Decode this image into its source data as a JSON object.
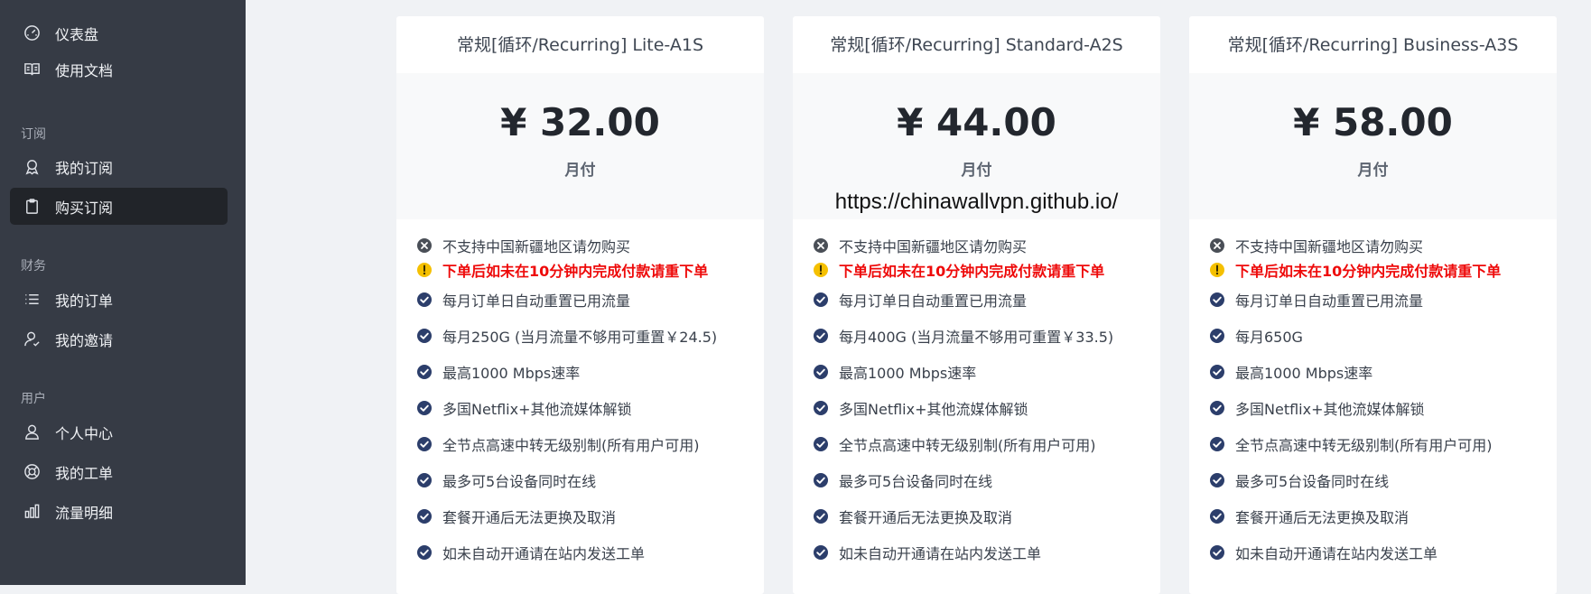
{
  "sidebar": {
    "items_top": [
      {
        "label": "仪表盘",
        "icon": "gauge-icon"
      },
      {
        "label": "使用文档",
        "icon": "book-icon"
      }
    ],
    "sections": [
      {
        "title": "订阅",
        "items": [
          {
            "label": "我的订阅",
            "icon": "rocket-icon",
            "active": false
          },
          {
            "label": "购买订阅",
            "icon": "clipboard-icon",
            "active": true
          }
        ]
      },
      {
        "title": "财务",
        "items": [
          {
            "label": "我的订单",
            "icon": "list-icon",
            "active": false
          },
          {
            "label": "我的邀请",
            "icon": "user-invite-icon",
            "active": false
          }
        ]
      },
      {
        "title": "用户",
        "items": [
          {
            "label": "个人中心",
            "icon": "user-icon",
            "active": false
          },
          {
            "label": "我的工单",
            "icon": "lifebuoy-icon",
            "active": false
          },
          {
            "label": "流量明细",
            "icon": "bar-chart-icon",
            "active": false
          }
        ]
      }
    ]
  },
  "plans": [
    {
      "title": "常规[循环/Recurring] Lite-A1S",
      "price": "¥ 32.00",
      "period": "月付",
      "features": [
        {
          "type": "x",
          "text": "不支持中国新疆地区请勿购买"
        },
        {
          "type": "warn",
          "text": "下单后如未在10分钟内完成付款请重下单"
        },
        {
          "type": "check",
          "text": "每月订单日自动重置已用流量"
        },
        {
          "type": "check",
          "text": "每月250G (当月流量不够用可重置￥24.5)"
        },
        {
          "type": "check",
          "text": "最高1000 Mbps速率"
        },
        {
          "type": "check",
          "text": "多国Netflix+其他流媒体解锁"
        },
        {
          "type": "check",
          "text": "全节点高速中转无级别制(所有用户可用)"
        },
        {
          "type": "check",
          "text": "最多可5台设备同时在线"
        },
        {
          "type": "check",
          "text": "套餐开通后无法更换及取消"
        },
        {
          "type": "check",
          "text": "如未自动开通请在站内发送工单"
        }
      ]
    },
    {
      "title": "常规[循环/Recurring] Standard-A2S",
      "price": "¥ 44.00",
      "period": "月付",
      "watermark": "https://chinawallvpn.github.io/",
      "features": [
        {
          "type": "x",
          "text": "不支持中国新疆地区请勿购买"
        },
        {
          "type": "warn",
          "text": "下单后如未在10分钟内完成付款请重下单"
        },
        {
          "type": "check",
          "text": "每月订单日自动重置已用流量"
        },
        {
          "type": "check",
          "text": "每月400G (当月流量不够用可重置￥33.5)"
        },
        {
          "type": "check",
          "text": "最高1000 Mbps速率"
        },
        {
          "type": "check",
          "text": "多国Netflix+其他流媒体解锁"
        },
        {
          "type": "check",
          "text": "全节点高速中转无级别制(所有用户可用)"
        },
        {
          "type": "check",
          "text": "最多可5台设备同时在线"
        },
        {
          "type": "check",
          "text": "套餐开通后无法更换及取消"
        },
        {
          "type": "check",
          "text": "如未自动开通请在站内发送工单"
        }
      ]
    },
    {
      "title": "常规[循环/Recurring] Business-A3S",
      "price": "¥ 58.00",
      "period": "月付",
      "features": [
        {
          "type": "x",
          "text": "不支持中国新疆地区请勿购买"
        },
        {
          "type": "warn",
          "text": "下单后如未在10分钟内完成付款请重下单"
        },
        {
          "type": "check",
          "text": "每月订单日自动重置已用流量"
        },
        {
          "type": "check",
          "text": "每月650G"
        },
        {
          "type": "check",
          "text": "最高1000 Mbps速率"
        },
        {
          "type": "check",
          "text": "多国Netflix+其他流媒体解锁"
        },
        {
          "type": "check",
          "text": "全节点高速中转无级别制(所有用户可用)"
        },
        {
          "type": "check",
          "text": "最多可5台设备同时在线"
        },
        {
          "type": "check",
          "text": "套餐开通后无法更换及取消"
        },
        {
          "type": "check",
          "text": "如未自动开通请在站内发送工单"
        }
      ]
    }
  ],
  "colors": {
    "sidebar_bg": "#363b45",
    "sidebar_active": "#212429",
    "check": "#2c3e6b",
    "warn": "#f5c000",
    "warn_text": "#ee0a0a",
    "x_icon": "#4a4f57"
  }
}
